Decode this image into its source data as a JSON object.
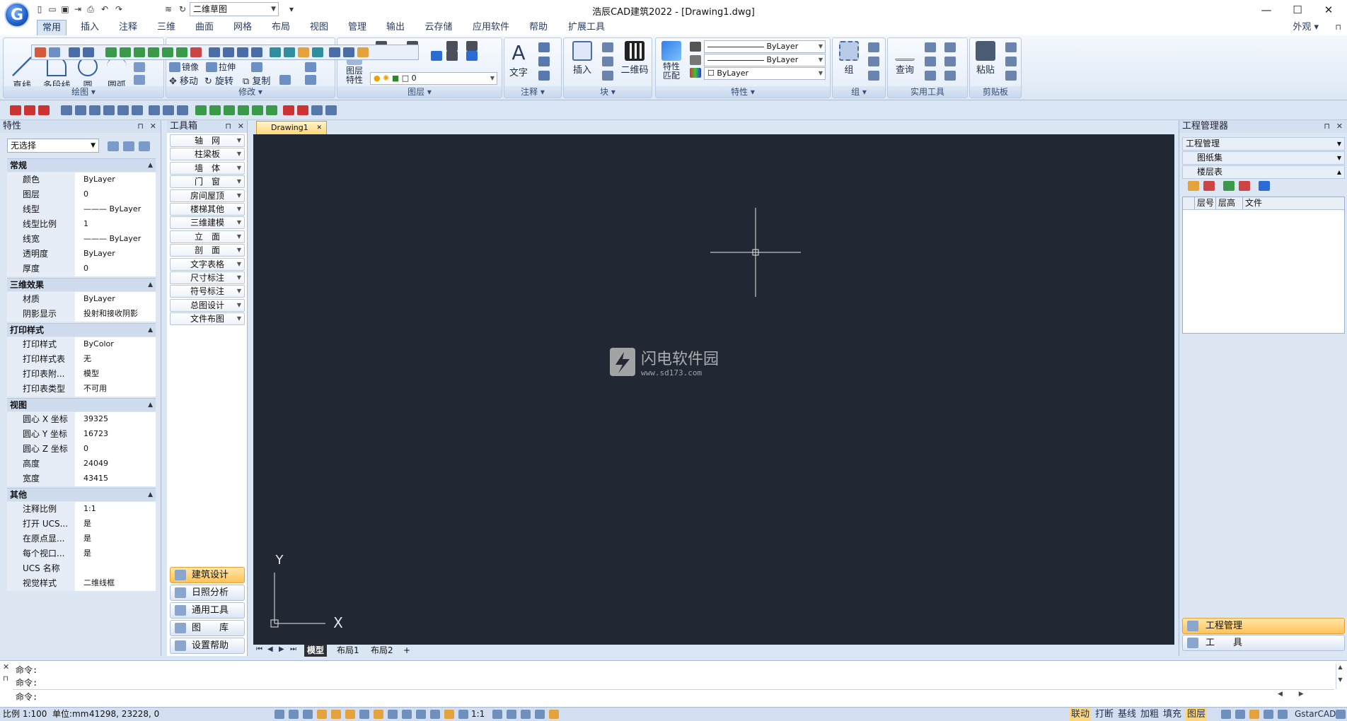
{
  "app": {
    "title": "浩辰CAD建筑2022 - [Drawing1.dwg]",
    "logo_letter": "G",
    "workspace": "二维草图",
    "appearance": "外观"
  },
  "menu_tabs": [
    "常用",
    "插入",
    "注释",
    "三维",
    "曲面",
    "网格",
    "布局",
    "视图",
    "管理",
    "输出",
    "云存储",
    "应用软件",
    "帮助",
    "扩展工具"
  ],
  "ribbon": {
    "draw": {
      "line": "直线",
      "polyline": "多段线",
      "circle": "圆",
      "arc": "圆弧",
      "group": "绘图"
    },
    "modify": {
      "mirror": "镜像",
      "stretch": "拉伸",
      "move": "移动",
      "rotate": "旋转",
      "copy": "复制",
      "group": "修改"
    },
    "layer": {
      "props": "图层\n特性",
      "combo": "0",
      "group": "图层"
    },
    "annot": {
      "text": "文字",
      "group": "注释"
    },
    "block": {
      "insert": "插入",
      "qr": "二维码",
      "group": "块"
    },
    "props": {
      "match": "特性\n匹配",
      "line1": "ByLayer",
      "line2": "ByLayer",
      "color": "ByLayer",
      "group": "特性"
    },
    "grp": {
      "group_btn": "组",
      "group": "组"
    },
    "util": {
      "query": "查询",
      "group": "实用工具"
    },
    "clip": {
      "paste": "粘贴",
      "group": "剪贴板"
    }
  },
  "properties": {
    "title": "特性",
    "selection": "无选择",
    "sections": [
      {
        "name": "常规",
        "rows": [
          [
            "颜色",
            "ByLayer"
          ],
          [
            "图层",
            "0"
          ],
          [
            "线型",
            "——— ByLayer"
          ],
          [
            "线型比例",
            "1"
          ],
          [
            "线宽",
            "——— ByLayer"
          ],
          [
            "透明度",
            "ByLayer"
          ],
          [
            "厚度",
            "0"
          ]
        ]
      },
      {
        "name": "三维效果",
        "rows": [
          [
            "材质",
            "ByLayer"
          ],
          [
            "阴影显示",
            "投射和接收阴影"
          ]
        ]
      },
      {
        "name": "打印样式",
        "rows": [
          [
            "打印样式",
            "ByColor"
          ],
          [
            "打印样式表",
            "无"
          ],
          [
            "打印表附...",
            "模型"
          ],
          [
            "打印表类型",
            "不可用"
          ]
        ]
      },
      {
        "name": "视图",
        "rows": [
          [
            "圆心 X 坐标",
            "39325"
          ],
          [
            "圆心 Y 坐标",
            "16723"
          ],
          [
            "圆心 Z 坐标",
            "0"
          ],
          [
            "高度",
            "24049"
          ],
          [
            "宽度",
            "43415"
          ]
        ]
      },
      {
        "name": "其他",
        "rows": [
          [
            "注释比例",
            "1:1"
          ],
          [
            "打开 UCS...",
            "是"
          ],
          [
            "在原点显...",
            "是"
          ],
          [
            "每个视口...",
            "是"
          ],
          [
            "UCS 名称",
            ""
          ],
          [
            "视觉样式",
            "二维线框"
          ]
        ]
      }
    ]
  },
  "toolbox": {
    "title": "工具箱",
    "items": [
      "轴　网",
      "柱梁板",
      "墙　体",
      "门　窗",
      "房间屋顶",
      "楼梯其他",
      "三维建模",
      "立　面",
      "剖　面",
      "文字表格",
      "尺寸标注",
      "符号标注",
      "总图设计",
      "文件布图"
    ],
    "categories": [
      "建筑设计",
      "日照分析",
      "通用工具",
      "图　　库",
      "设置帮助"
    ]
  },
  "drawing": {
    "tab": "Drawing1",
    "layout_tabs": [
      "模型",
      "布局1",
      "布局2",
      "+"
    ],
    "axis_x": "X",
    "axis_y": "Y",
    "watermark_title": "闪电软件园",
    "watermark_url": "www.sd173.com"
  },
  "project": {
    "title": "工程管理器",
    "combo": "工程管理",
    "rows": [
      "图纸集",
      "楼层表"
    ],
    "columns": [
      "层号",
      "层高",
      "文件"
    ],
    "bottom_tabs": [
      "工程管理",
      "工　　具"
    ]
  },
  "command": {
    "lines": [
      "命令:",
      "命令:"
    ],
    "prompt": "命令:"
  },
  "status": {
    "scale": "比例 1:100",
    "units": "单位:mm",
    "coords": "41298, 23228, 0",
    "annot_scale": "1:1",
    "toggles": [
      "联动",
      "打断",
      "基线",
      "加粗",
      "填充",
      "图层"
    ],
    "brand": "GstarCAD"
  },
  "colors": {
    "canvas": "#222833",
    "accent": "#ffc35a",
    "ribbon": "#dbe6f4"
  }
}
